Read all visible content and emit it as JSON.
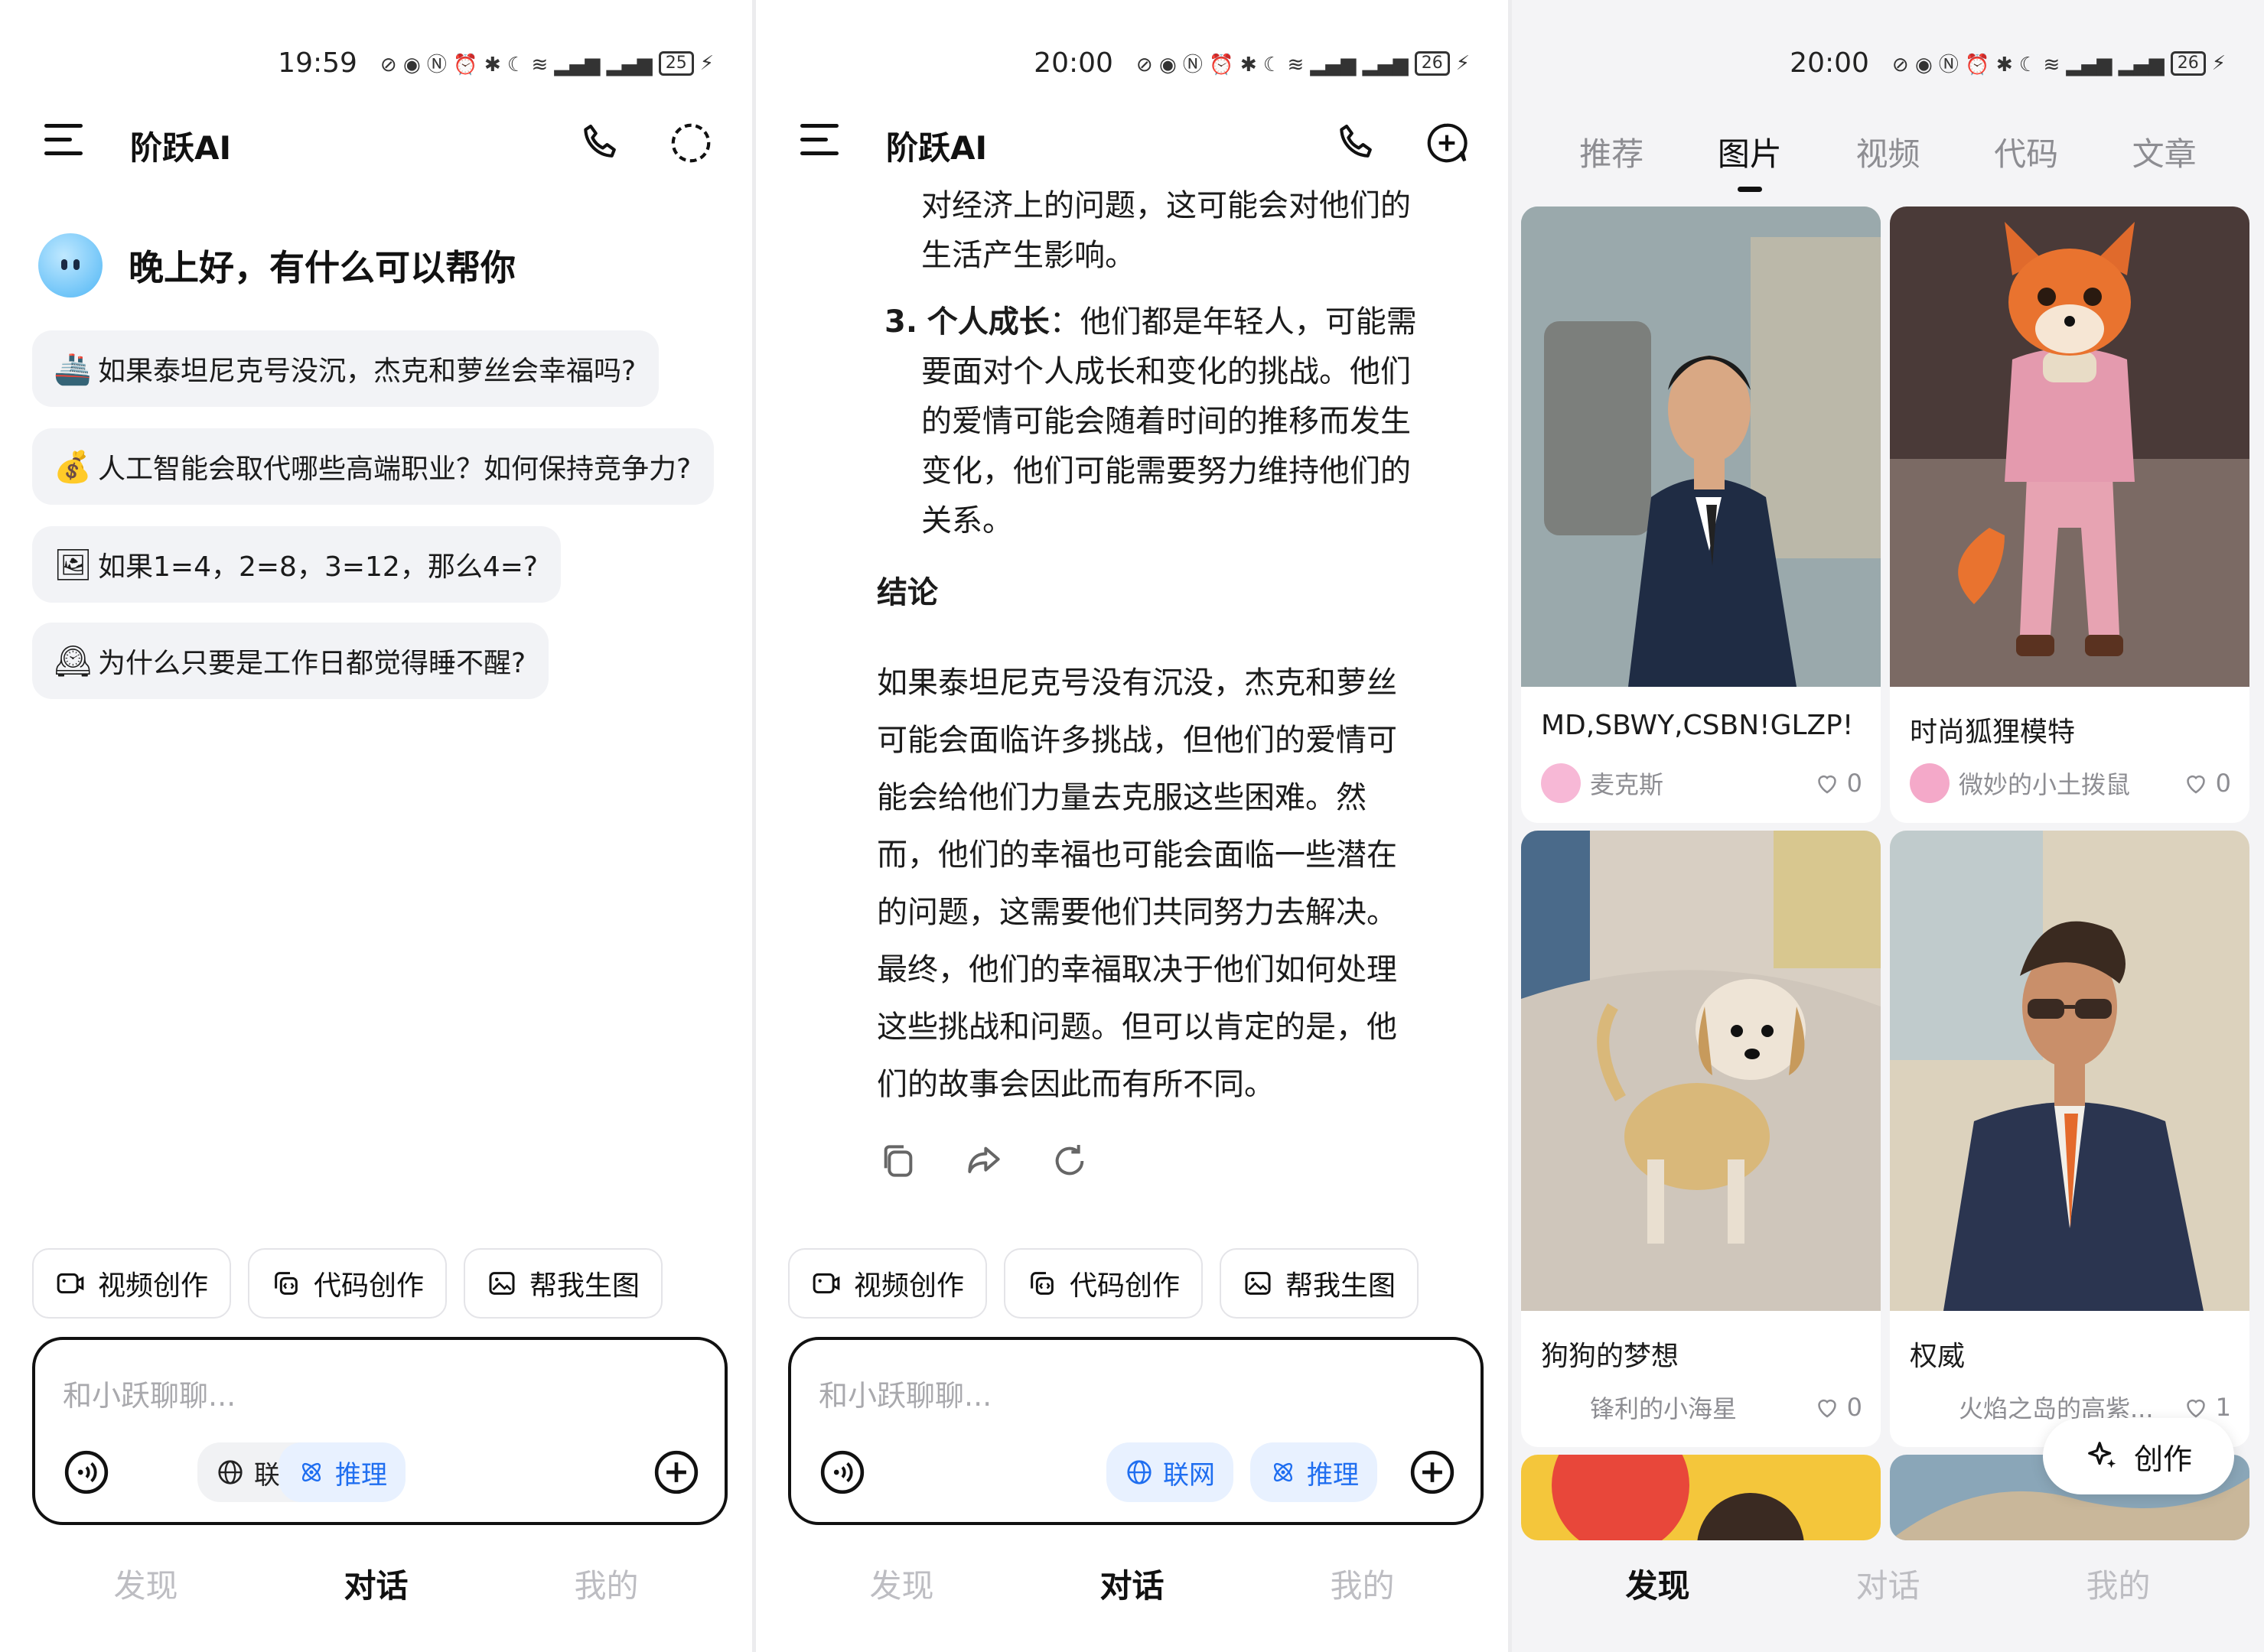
{
  "status_bar": [
    {
      "time": "19:59",
      "battery": "25"
    },
    {
      "time": "20:00",
      "battery": "26"
    },
    {
      "time": "20:00",
      "battery": "26"
    }
  ],
  "app": {
    "title": "阶跃AI"
  },
  "home": {
    "greeting": "晚上好，有什么可以帮你",
    "suggestions": [
      {
        "icon": "ship-icon",
        "glyph": "🚢",
        "text": "如果泰坦尼克号没沉，杰克和萝丝会幸福吗?"
      },
      {
        "icon": "money-bag-icon",
        "glyph": "💰",
        "text": "人工智能会取代哪些高端职业？如何保持竞争力?"
      },
      {
        "icon": "thumbnail-icon",
        "glyph": "🖼",
        "text": "如果1=4，2=8，3=12，那么4=?"
      },
      {
        "icon": "clock-icon",
        "glyph": "🕰",
        "text": "为什么只要是工作日都觉得睡不醒?"
      }
    ]
  },
  "chips": [
    {
      "icon": "video-icon",
      "label": "视频创作"
    },
    {
      "icon": "code-icon",
      "label": "代码创作"
    },
    {
      "icon": "image-icon",
      "label": "帮我生图"
    }
  ],
  "input": {
    "placeholder": "和小跃聊聊...",
    "web_label": "联网",
    "reason_label": "推理"
  },
  "nav": {
    "discover": "发现",
    "chat": "对话",
    "me": "我的"
  },
  "chat": {
    "lines": [
      "对经济上的问题，这可能会对他们的",
      "生活产生影响。"
    ],
    "item3_num": "3.",
    "item3_title": "个人成长",
    "item3_lines": [
      "：他们都是年轻人，可能需",
      "要面对个人成长和变化的挑战。他们",
      "的爱情可能会随着时间的推移而发生",
      "变化，他们可能需要努力维持他们的",
      "关系。"
    ],
    "conclusion_heading": "结论",
    "conclusion_lines": [
      "如果泰坦尼克号没有沉没，杰克和萝丝",
      "可能会面临许多挑战，但他们的爱情可",
      "能会给他们力量去克服这些困难。然",
      "而，他们的幸福也可能会面临一些潜在",
      "的问题，这需要他们共同努力去解决。",
      "最终，他们的幸福取决于他们如何处理",
      "这些挑战和问题。但可以肯定的是，他",
      "们的故事会因此而有所不同。"
    ]
  },
  "discover": {
    "tabs": [
      "推荐",
      "图片",
      "视频",
      "代码",
      "文章"
    ],
    "active_tab": "图片",
    "cards": [
      {
        "title": "MD,SBWY,CSBN!GLZP!",
        "author": "麦克斯",
        "likes": "0"
      },
      {
        "title": "时尚狐狸模特",
        "author": "微妙的小土拨鼠",
        "likes": "0"
      },
      {
        "title": "狗狗的梦想",
        "author": "锋利的小海星",
        "likes": "0"
      },
      {
        "title": "权威",
        "author": "火焰之岛的高紫...",
        "likes": "1"
      }
    ],
    "create_label": "创作"
  }
}
